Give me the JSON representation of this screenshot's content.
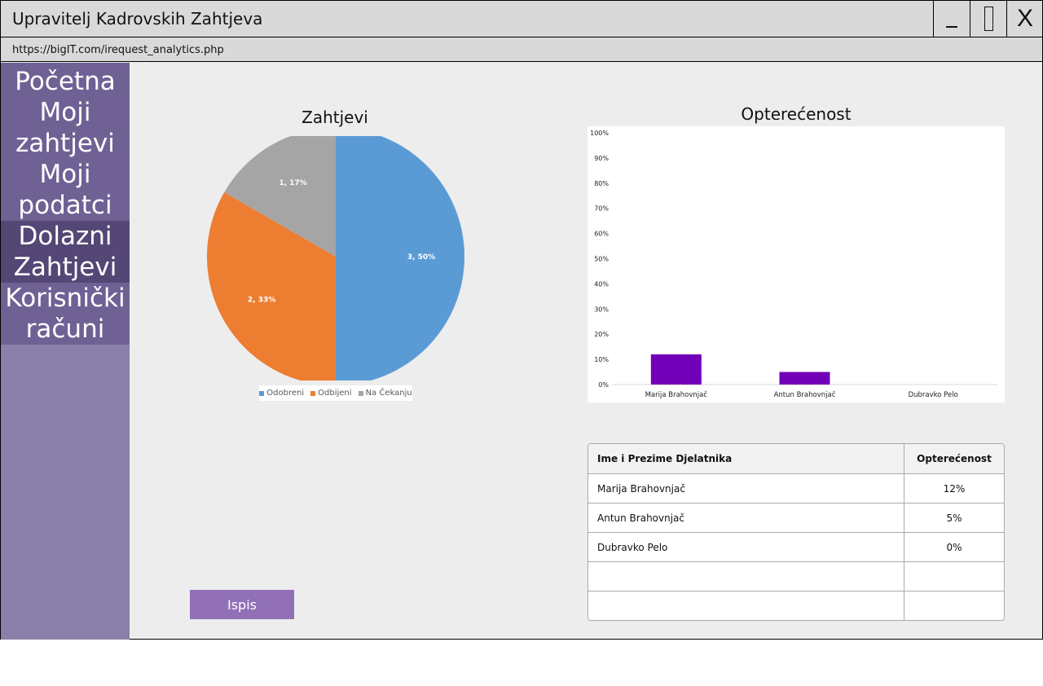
{
  "window": {
    "title": "Upravitelj Kadrovskih Zahtjeva",
    "close_label": "X",
    "url": "https://bigIT.com/irequest_analytics.php"
  },
  "sidebar": {
    "items": [
      {
        "label": "Početna",
        "active": false
      },
      {
        "label": "Moji zahtjevi",
        "active": false
      },
      {
        "label": "Moji podatci",
        "active": false
      },
      {
        "label": "Dolazni Zahtjevi",
        "active": true
      },
      {
        "label": "Korisnički računi",
        "active": false
      }
    ]
  },
  "main": {
    "print_button": "Ispis"
  },
  "chart_data": [
    {
      "type": "pie",
      "title": "Zahtjevi",
      "categories": [
        "Odobreni",
        "Odbijeni",
        "Na Čekanju"
      ],
      "values": [
        3,
        2,
        1
      ],
      "data_labels": [
        "3, 50%",
        "2, 33%",
        "1, 17%"
      ],
      "colors": [
        "#5b9bd5",
        "#ed7d31",
        "#a5a5a5"
      ],
      "legend": "bottom"
    },
    {
      "type": "bar",
      "title": "Opterećenost",
      "categories": [
        "Marija Brahovnjač",
        "Antun Brahovnjač",
        "Dubravko Pelo"
      ],
      "values": [
        12,
        5,
        0
      ],
      "ylim": [
        0,
        100
      ],
      "yticks": [
        "0%",
        "10%",
        "20%",
        "30%",
        "40%",
        "50%",
        "60%",
        "70%",
        "80%",
        "90%",
        "100%"
      ],
      "color": "#7200b8",
      "grid": false
    }
  ],
  "table": {
    "headers": [
      "Ime i Prezime Djelatnika",
      "Opterećenost"
    ],
    "rows": [
      [
        "Marija Brahovnjač",
        "12%"
      ],
      [
        "Antun Brahovnjač",
        "5%"
      ],
      [
        "Dubravko Pelo",
        "0%"
      ],
      [
        "",
        ""
      ],
      [
        "",
        ""
      ]
    ]
  }
}
